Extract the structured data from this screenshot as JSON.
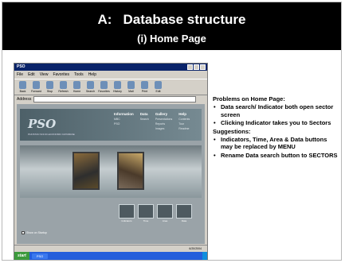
{
  "title": {
    "prefix": "A:",
    "main": "Database structure",
    "subtitle": "(i) Home Page"
  },
  "browser": {
    "window_title": "PSO",
    "menu": [
      "File",
      "Edit",
      "View",
      "Favorites",
      "Tools",
      "Help"
    ],
    "toolbar": [
      "Back",
      "Forward",
      "Stop",
      "Refresh",
      "Home",
      "Search",
      "Favorites",
      "History",
      "Mail",
      "Print",
      "Edit"
    ],
    "address_label": "Address",
    "address_value": "",
    "site": {
      "logo": "PSO",
      "logo_sub": "PAKISTAN SOCIO-ECONOMIC DATABASE",
      "nav": [
        {
          "head": "Information",
          "subs": [
            "MBC",
            "PSO"
          ]
        },
        {
          "head": "Data",
          "subs": [
            "Search"
          ]
        },
        {
          "head": "Gallery",
          "subs": [
            "Presentations",
            "Reports",
            "Images"
          ]
        },
        {
          "head": "Help",
          "subs": [
            "Contents",
            "Tour",
            "Readme"
          ]
        }
      ],
      "thumbs": [
        "Indicators",
        "Time",
        "Area",
        "Data"
      ],
      "show_on_startup": "Show on Startup"
    },
    "status": {
      "left": "",
      "right": "6/20/2004"
    },
    "taskbar": {
      "start": "start",
      "task": "PSO",
      "tray": ""
    }
  },
  "notes": {
    "problems_heading": "Problems on Home Page:",
    "problems": [
      "Data search/ Indicator both open sector screen",
      "Clicking Indicator takes you to Sectors"
    ],
    "suggestions_heading": "Suggestions:",
    "suggestions": [
      "Indicators, Time, Area & Data buttons may be replaced by MENU",
      "Rename Data search button to  SECTORS"
    ]
  }
}
